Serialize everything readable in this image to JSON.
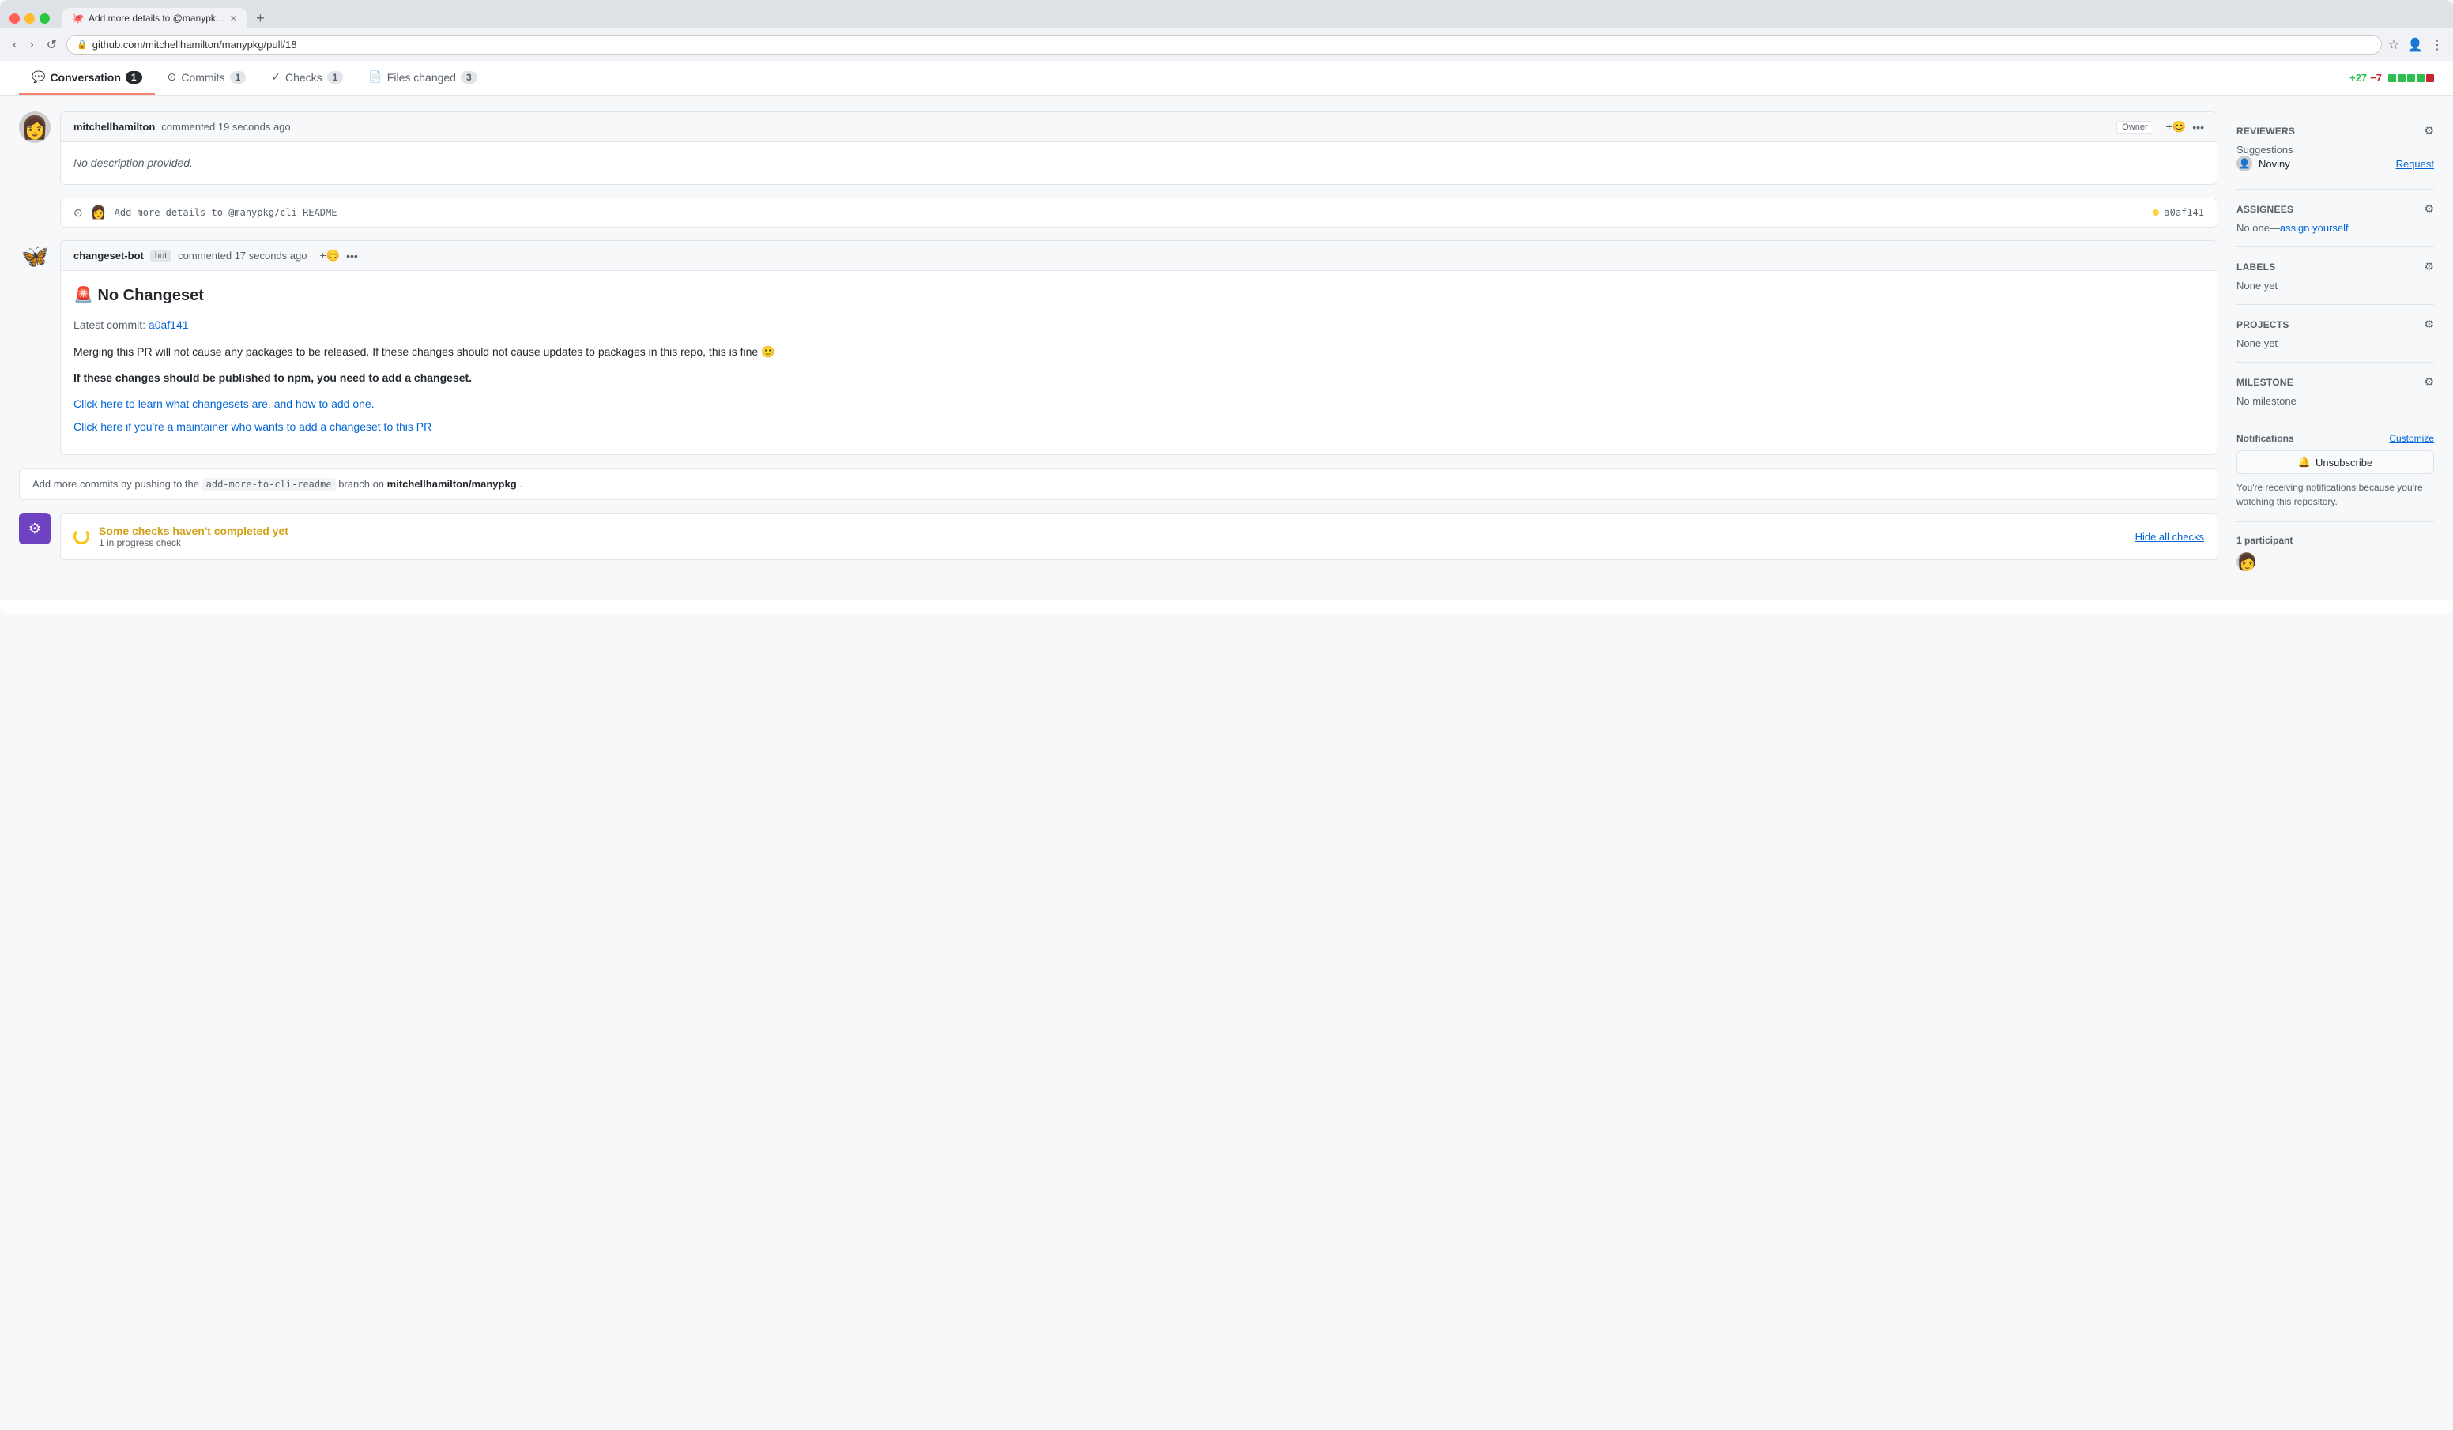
{
  "browser": {
    "tab_title": "Add more details to @manypk…",
    "url": "github.com/mitchellhamilton/manypkg/pull/18",
    "new_tab_label": "+"
  },
  "pr_tabs": [
    {
      "id": "conversation",
      "icon": "💬",
      "label": "Conversation",
      "badge": "1",
      "active": true
    },
    {
      "id": "commits",
      "icon": "⊙",
      "label": "Commits",
      "badge": "1",
      "active": false
    },
    {
      "id": "checks",
      "icon": "✓",
      "label": "Checks",
      "badge": "1",
      "active": false
    },
    {
      "id": "files_changed",
      "icon": "📄",
      "label": "Files changed",
      "badge": "3",
      "active": false
    }
  ],
  "diff_stat": {
    "additions": "+27",
    "deletions": "−7",
    "blocks": [
      "green",
      "green",
      "green",
      "green",
      "red"
    ]
  },
  "first_comment": {
    "author": "mitchellhamilton",
    "action": "commented",
    "time": "19 seconds ago",
    "badge": "Owner",
    "body": "No description provided."
  },
  "commit_ref": {
    "message": "Add more details to @manypkg/cli README",
    "sha": "a0af141",
    "status": "pending"
  },
  "bot_comment": {
    "author": "changeset-bot",
    "bot_label": "bot",
    "action": "commented",
    "time": "17 seconds ago",
    "title": "🚨 No Changeset",
    "latest_commit_label": "Latest commit:",
    "latest_commit_sha": "a0af141",
    "merge_note": "Merging this PR will not cause any packages to be released. If these changes should not cause updates to packages in this repo, this is fine 🙂",
    "npm_note": "If these changes should be published to npm, you need to add a changeset.",
    "learn_link": "Click here to learn what changesets are, and how to add one.",
    "maintainer_link": "Click here if you're a maintainer who wants to add a changeset to this PR"
  },
  "branch_info": {
    "prefix": "Add more commits by pushing to the",
    "branch": "add-more-to-cli-readme",
    "middle": "branch on",
    "repo": "mitchellhamilton/manypkg",
    "suffix": "."
  },
  "checks": {
    "title": "Some checks haven't completed yet",
    "subtitle": "1 in progress check",
    "action": "Hide all checks"
  },
  "sidebar": {
    "reviewers": {
      "title": "Reviewers",
      "suggestions_label": "Suggestions",
      "reviewer_name": "Noviny",
      "request_label": "Request"
    },
    "assignees": {
      "title": "Assignees",
      "value": "No one—assign yourself",
      "assign_label": "assign yourself"
    },
    "labels": {
      "title": "Labels",
      "value": "None yet"
    },
    "projects": {
      "title": "Projects",
      "value": "None yet"
    },
    "milestone": {
      "title": "Milestone",
      "value": "No milestone"
    },
    "notifications": {
      "title": "Notifications",
      "customize_label": "Customize",
      "unsubscribe_label": "Unsubscribe",
      "note": "You're receiving notifications because you're watching this repository."
    },
    "participants": {
      "count_label": "1 participant"
    }
  }
}
